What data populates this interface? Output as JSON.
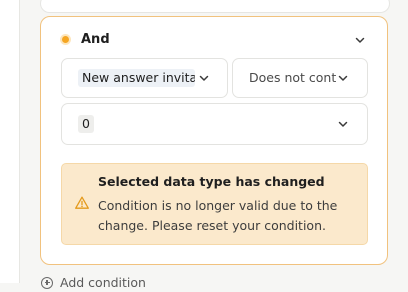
{
  "condition": {
    "operator_label": "And",
    "field_value": "New answer invita",
    "comparison_value": "Does not cont",
    "input_value": "0"
  },
  "warning": {
    "title": "Selected data type has changed",
    "message": "Condition is no longer valid due to the change. Please reset your condition."
  },
  "footer": {
    "add_condition_label": "Add condition"
  },
  "colors": {
    "card_border": "#f1c27e",
    "status_dot": "#f5a623",
    "warning_bg": "#fbe9cc",
    "warning_icon": "#e49a1c"
  },
  "icons": {
    "status": "status-dot-icon",
    "collapse": "chevron-down-icon",
    "warning": "warning-triangle-icon",
    "add": "plus-circle-icon"
  }
}
